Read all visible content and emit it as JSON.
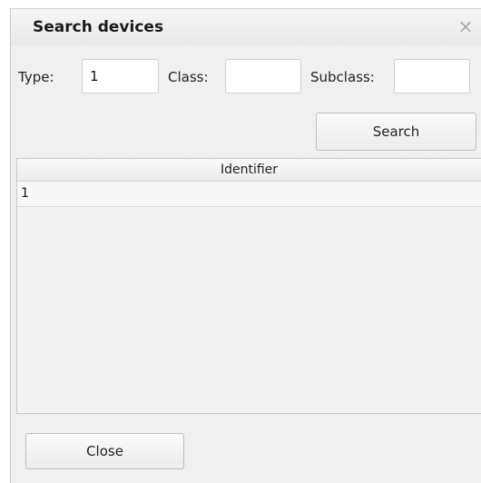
{
  "dialog": {
    "title": "Search devices",
    "close_icon_glyph": "×"
  },
  "filters": {
    "type_label": "Type:",
    "type_value": "1",
    "class_label": "Class:",
    "class_value": "",
    "subclass_label": "Subclass:",
    "subclass_value": ""
  },
  "search_button": "Search",
  "results": {
    "columns": [
      "Identifier"
    ],
    "rows": [
      [
        "1"
      ]
    ]
  },
  "close_button": "Close"
}
